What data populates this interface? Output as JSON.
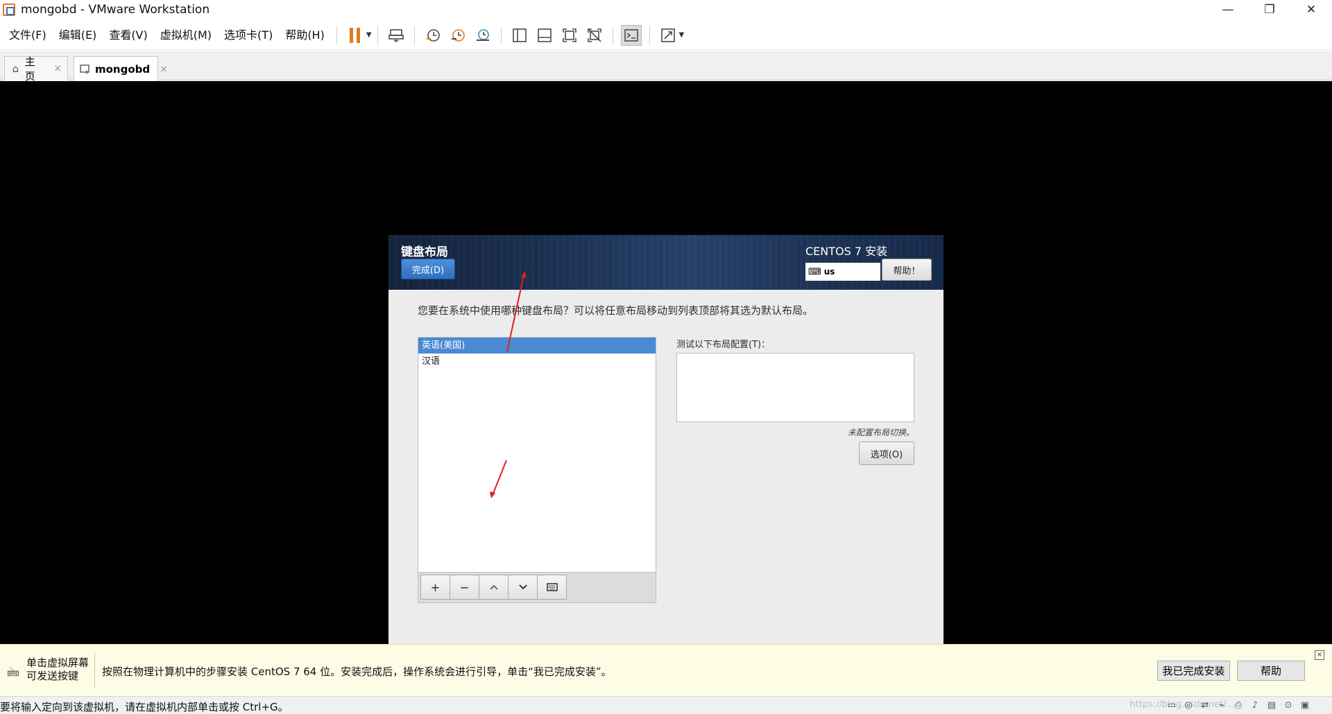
{
  "window": {
    "title": "mongobd - VMware Workstation",
    "controls": {
      "minimize": "—",
      "restore": "❐",
      "close": "✕"
    }
  },
  "menu": [
    "文件(F)",
    "编辑(E)",
    "查看(V)",
    "虚拟机(M)",
    "选项卡(T)",
    "帮助(H)"
  ],
  "tabs": {
    "home": {
      "label": "主页",
      "close": "×"
    },
    "vm": {
      "label": "mongobd",
      "close": "×"
    }
  },
  "installer": {
    "title": "键盘布局",
    "done_button": "完成(D)",
    "product": "CENTOS 7 安装",
    "keyboard_value": "us",
    "help_button": "帮助！",
    "description": "您要在系统中使用哪种键盘布局？可以将任意布局移动到列表顶部将其选为默认布局。",
    "layouts": [
      {
        "label": "英语(美国)",
        "selected": true
      },
      {
        "label": "汉语",
        "selected": false
      }
    ],
    "list_buttons": {
      "add": "+",
      "remove": "−",
      "up": "⌃",
      "down": "⌄",
      "preview": "⌨"
    },
    "test_label": "测试以下布局配置(T)：",
    "no_switch": "未配置布局切换。",
    "options_button": "选项(O)"
  },
  "hint": {
    "left_line1": "单击虚拟屏幕",
    "left_line2": "可发送按键",
    "message": "按照在物理计算机中的步骤安装 CentOS 7 64 位。安装完成后，操作系统会进行引导，单击“我已完成安装”。",
    "finish_button": "我已完成安装",
    "help_button": "帮助",
    "close": "×"
  },
  "status": {
    "text": "要将输入定向到该虚拟机，请在虚拟机内部单击或按 Ctrl+G。",
    "watermark": "https://blog.csdn.net/..."
  }
}
